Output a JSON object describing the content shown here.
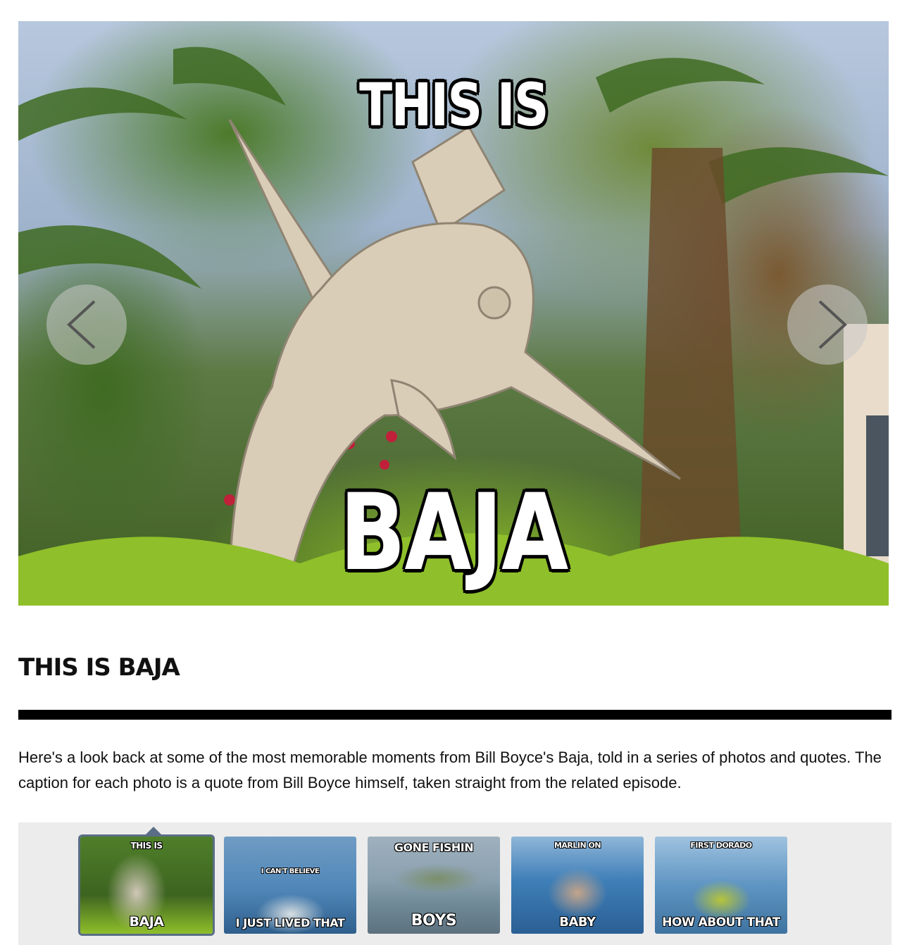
{
  "slide": {
    "caption_top": "THIS IS",
    "caption_bottom": "BAJA",
    "prev_icon": "chevron-left-icon",
    "next_icon": "chevron-right-icon"
  },
  "article": {
    "title": "THIS IS BAJA",
    "description": "Here's a look back at some of the most memorable moments from Bill Boyce's Baja, told in a series of photos and quotes. The caption for each photo is a quote from Bill Boyce himself, taken straight from the related episode."
  },
  "thumbnails": [
    {
      "top": "THIS IS",
      "bottom": "BAJA",
      "active": true
    },
    {
      "top": "",
      "middle": "I CAN'T BELIEVE",
      "bottom": "I JUST LIVED THAT",
      "active": false
    },
    {
      "top": "GONE FISHIN",
      "bottom": "BOYS",
      "active": false
    },
    {
      "top": "MARLIN ON",
      "bottom": "BABY",
      "active": false
    },
    {
      "top": "FIRST DORADO",
      "bottom": "HOW ABOUT THAT",
      "active": false
    }
  ],
  "colors": {
    "rule": "#000000",
    "strip_background": "#ececec",
    "active_border": "#5a6d86"
  }
}
